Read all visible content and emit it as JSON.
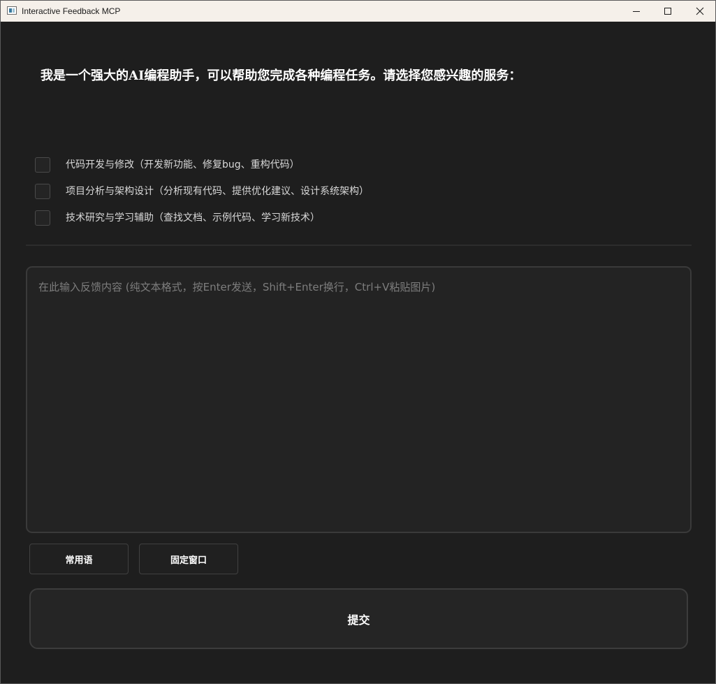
{
  "window": {
    "title": "Interactive Feedback MCP",
    "controls": {
      "minimize": "minimize-icon",
      "maximize": "maximize-icon",
      "close": "close-icon"
    }
  },
  "prompt": "我是一个强大的AI编程助手，可以帮助您完成各种编程任务。请选择您感兴趣的服务：",
  "options": [
    {
      "label": "代码开发与修改（开发新功能、修复bug、重构代码）",
      "checked": false
    },
    {
      "label": "项目分析与架构设计（分析现有代码、提供优化建议、设计系统架构）",
      "checked": false
    },
    {
      "label": "技术研究与学习辅助（查找文档、示例代码、学习新技术）",
      "checked": false
    }
  ],
  "feedback": {
    "value": "",
    "placeholder": "在此输入反馈内容 (纯文本格式，按Enter发送，Shift+Enter换行，Ctrl+V粘贴图片)"
  },
  "buttons": {
    "phrases": "常用语",
    "pin_window": "固定窗口",
    "submit": "提交"
  },
  "colors": {
    "background": "#1e1e1e",
    "titlebar": "#f5f0ea",
    "input_border": "#3a3a3a",
    "text": "#ffffff",
    "placeholder": "#7d7d7d"
  }
}
